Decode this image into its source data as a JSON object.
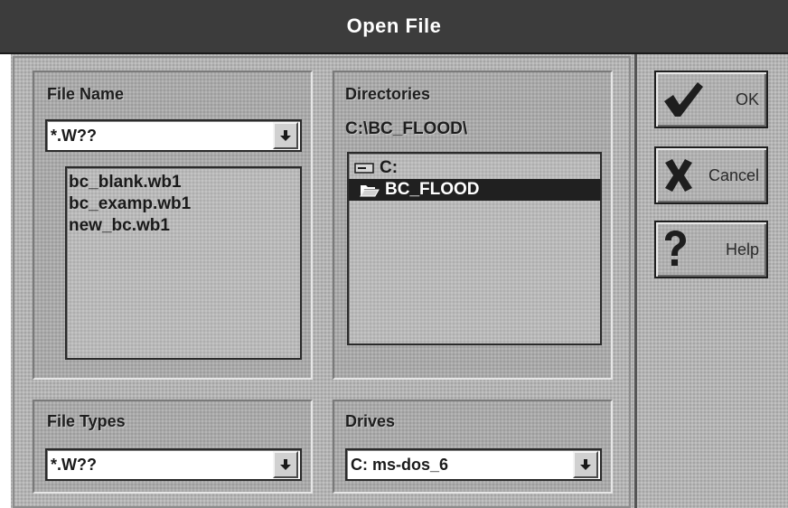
{
  "window": {
    "title": "Open File"
  },
  "file_name": {
    "label": "File Name",
    "filter_value": "*.W??",
    "files": [
      "bc_blank.wb1",
      "bc_examp.wb1",
      "new_bc.wb1"
    ]
  },
  "directories": {
    "label": "Directories",
    "current_path": "C:\\BC_FLOOD\\",
    "tree": [
      {
        "label": "C:",
        "icon": "drive-icon",
        "selected": false
      },
      {
        "label": "BC_FLOOD",
        "icon": "open-folder-icon",
        "selected": true
      }
    ]
  },
  "file_types": {
    "label": "File Types",
    "value": "*.W??"
  },
  "drives": {
    "label": "Drives",
    "value": "C: ms-dos_6"
  },
  "buttons": {
    "ok_label": "OK",
    "cancel_label": "Cancel",
    "help_label": "Help"
  },
  "colors": {
    "titlebar": "#3c3c3c",
    "selection": "#202020",
    "face": "#b4b4b4"
  }
}
